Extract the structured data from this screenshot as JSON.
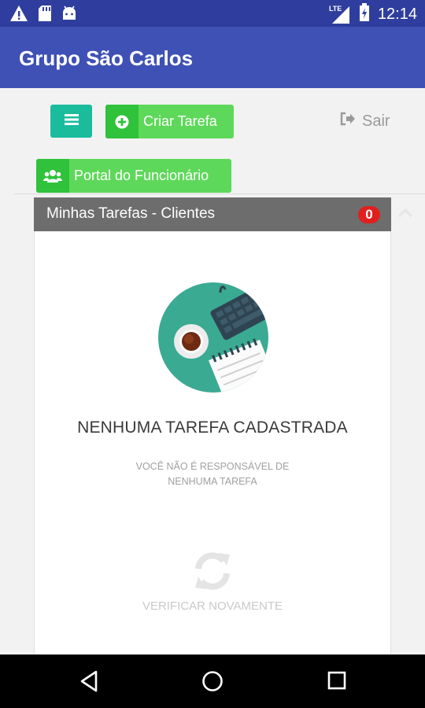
{
  "status_bar": {
    "time": "12:14",
    "network_label": "LTE",
    "icons": [
      "warning-icon",
      "sd-card-icon",
      "android-icon",
      "signal-icon",
      "battery-icon"
    ]
  },
  "app": {
    "title": "Grupo São Carlos",
    "colors": {
      "primary": "#3f51b5",
      "primary_dark": "#2f3e9e",
      "accent_teal": "#1abc9c",
      "green": "#5ed85a",
      "badge_red": "#e0201f"
    }
  },
  "toolbar": {
    "menu_icon": "hamburger-icon",
    "create_task_label": "Criar Tarefa",
    "create_task_icon": "plus-circle-icon",
    "logout_label": "Sair",
    "logout_icon": "sign-out-icon",
    "portal_label": "Portal do Funcionário",
    "portal_icon": "users-icon"
  },
  "panel": {
    "title": "Minhas Tarefas - Clientes",
    "count": "0",
    "collapse_icon": "chevron-up-icon",
    "empty_title": "NENHUMA TAREFA CADASTRADA",
    "empty_subtitle_line1": "VOCÊ NÃO É RESPONSÁVEL DE",
    "empty_subtitle_line2": "NENHUMA TAREFA",
    "refresh_icon": "refresh-icon",
    "verify_label": "VERIFICAR NOVAMENTE"
  },
  "nav_bar": {
    "items": [
      "back-icon",
      "home-icon",
      "recent-apps-icon"
    ]
  }
}
